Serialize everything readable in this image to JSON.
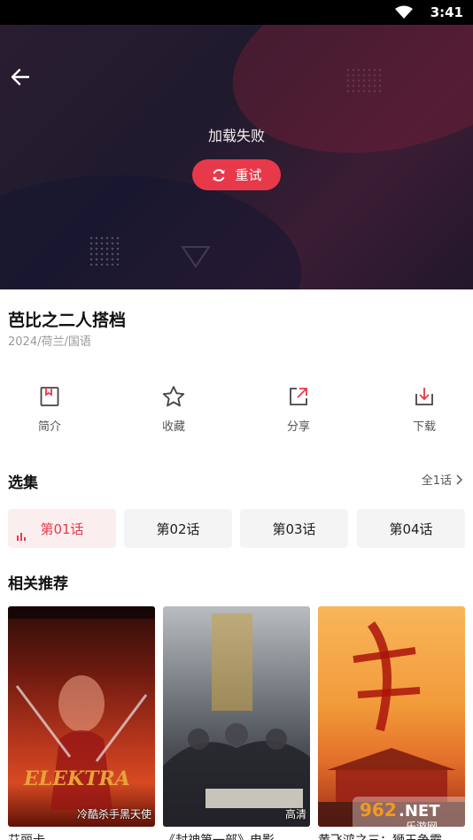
{
  "status": {
    "time": "3:41"
  },
  "player": {
    "fail_text": "加载失败",
    "retry_label": "重试"
  },
  "show": {
    "title": "芭比之二人搭档",
    "meta": "2024/荷兰/国语"
  },
  "actions": [
    {
      "label": "简介",
      "icon": "info-bookmark-icon"
    },
    {
      "label": "收藏",
      "icon": "star-icon"
    },
    {
      "label": "分享",
      "icon": "share-icon"
    },
    {
      "label": "下载",
      "icon": "download-icon"
    }
  ],
  "episodes": {
    "title": "选集",
    "all_label": "全1话",
    "items": [
      {
        "label": "第01话",
        "active": true
      },
      {
        "label": "第02话",
        "active": false
      },
      {
        "label": "第03话",
        "active": false
      },
      {
        "label": "第04话",
        "active": false
      }
    ]
  },
  "related": {
    "title": "相关推荐",
    "items": [
      {
        "poster_text": "冷酷杀手黑天使",
        "caption": "艾丽卡"
      },
      {
        "poster_text": "高清",
        "caption": "《封神第一部》电影"
      },
      {
        "poster_text": "",
        "caption": "黄飞鸿之三：狮王争霸"
      }
    ]
  },
  "watermark": "962.NET 乐游网",
  "colors": {
    "accent": "#e8394a"
  }
}
